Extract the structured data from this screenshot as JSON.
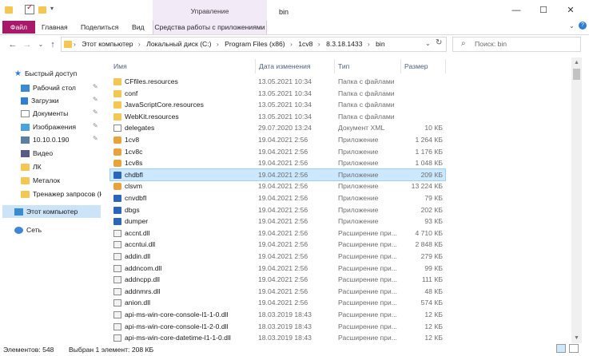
{
  "window": {
    "title": "bin",
    "contextual_group": "Управление",
    "controls": {
      "minimize": "—",
      "maximize": "☐",
      "close": "✕"
    }
  },
  "ribbon": {
    "tabs": [
      "Файл",
      "Главная",
      "Поделиться",
      "Вид",
      "Средства работы с приложениями"
    ]
  },
  "address": {
    "crumbs": [
      "Этот компьютер",
      "Локальный диск (C:)",
      "Program Files (x86)",
      "1cv8",
      "8.3.18.1433",
      "bin"
    ],
    "separator": "›",
    "search_placeholder": "Поиск: bin"
  },
  "nav_pane": {
    "items": [
      {
        "label": "Быстрый доступ",
        "icon": "star-icon",
        "pinned": false
      },
      {
        "label": "Рабочий стол",
        "icon": "desktop-icon",
        "pinned": true
      },
      {
        "label": "Загрузки",
        "icon": "downloads-icon",
        "pinned": true
      },
      {
        "label": "Документы",
        "icon": "documents-icon",
        "pinned": true
      },
      {
        "label": "Изображения",
        "icon": "pictures-icon",
        "pinned": true
      },
      {
        "label": "10.10.0.190",
        "icon": "network-drive-icon",
        "pinned": true
      },
      {
        "label": "Видео",
        "icon": "video-icon",
        "pinned": false
      },
      {
        "label": "ЛК",
        "icon": "folder-icon",
        "pinned": false
      },
      {
        "label": "Металок",
        "icon": "folder-icon",
        "pinned": false
      },
      {
        "label": "Тренажер запросов (К",
        "icon": "folder-icon",
        "pinned": false
      },
      {
        "label": "Этот компьютер",
        "icon": "this-pc-icon",
        "pinned": false,
        "selected": true
      },
      {
        "label": "Сеть",
        "icon": "network-icon",
        "pinned": false
      }
    ]
  },
  "columns": [
    "Имя",
    "Дата изменения",
    "Тип",
    "Размер"
  ],
  "files": [
    {
      "name": "CFfiles.resources",
      "date": "13.05.2021 10:34",
      "type": "Папка с файлами",
      "size": "",
      "icon": "folder"
    },
    {
      "name": "conf",
      "date": "13.05.2021 10:34",
      "type": "Папка с файлами",
      "size": "",
      "icon": "folder"
    },
    {
      "name": "JavaScriptCore.resources",
      "date": "13.05.2021 10:34",
      "type": "Папка с файлами",
      "size": "",
      "icon": "folder"
    },
    {
      "name": "WebKit.resources",
      "date": "13.05.2021 10:34",
      "type": "Папка с файлами",
      "size": "",
      "icon": "folder"
    },
    {
      "name": "delegates",
      "date": "29.07.2020 13:24",
      "type": "Документ XML",
      "size": "10 КБ",
      "icon": "file"
    },
    {
      "name": "1cv8",
      "date": "19.04.2021 2:56",
      "type": "Приложение",
      "size": "1 264 КБ",
      "icon": "app1c"
    },
    {
      "name": "1cv8c",
      "date": "19.04.2021 2:56",
      "type": "Приложение",
      "size": "1 176 КБ",
      "icon": "app1c"
    },
    {
      "name": "1cv8s",
      "date": "19.04.2021 2:56",
      "type": "Приложение",
      "size": "1 048 КБ",
      "icon": "app1c"
    },
    {
      "name": "chdbfl",
      "date": "19.04.2021 2:56",
      "type": "Приложение",
      "size": "209 КБ",
      "icon": "appgen",
      "selected": true
    },
    {
      "name": "clsvm",
      "date": "19.04.2021 2:56",
      "type": "Приложение",
      "size": "13 224 КБ",
      "icon": "app1c"
    },
    {
      "name": "cnvdbfl",
      "date": "19.04.2021 2:56",
      "type": "Приложение",
      "size": "79 КБ",
      "icon": "appgen"
    },
    {
      "name": "dbgs",
      "date": "19.04.2021 2:56",
      "type": "Приложение",
      "size": "202 КБ",
      "icon": "appgen"
    },
    {
      "name": "dumper",
      "date": "19.04.2021 2:56",
      "type": "Приложение",
      "size": "93 КБ",
      "icon": "appgen"
    },
    {
      "name": "accnt.dll",
      "date": "19.04.2021 2:56",
      "type": "Расширение при...",
      "size": "4 710 КБ",
      "icon": "dll"
    },
    {
      "name": "accntui.dll",
      "date": "19.04.2021 2:56",
      "type": "Расширение при...",
      "size": "2 848 КБ",
      "icon": "dll"
    },
    {
      "name": "addin.dll",
      "date": "19.04.2021 2:56",
      "type": "Расширение при...",
      "size": "279 КБ",
      "icon": "dll"
    },
    {
      "name": "addncom.dll",
      "date": "19.04.2021 2:56",
      "type": "Расширение при...",
      "size": "99 КБ",
      "icon": "dll"
    },
    {
      "name": "addncpp.dll",
      "date": "19.04.2021 2:56",
      "type": "Расширение при...",
      "size": "111 КБ",
      "icon": "dll"
    },
    {
      "name": "addnmrs.dll",
      "date": "19.04.2021 2:56",
      "type": "Расширение при...",
      "size": "48 КБ",
      "icon": "dll"
    },
    {
      "name": "anion.dll",
      "date": "19.04.2021 2:56",
      "type": "Расширение при...",
      "size": "574 КБ",
      "icon": "dll"
    },
    {
      "name": "api-ms-win-core-console-l1-1-0.dll",
      "date": "18.03.2019 18:43",
      "type": "Расширение при...",
      "size": "12 КБ",
      "icon": "dll"
    },
    {
      "name": "api-ms-win-core-console-l1-2-0.dll",
      "date": "18.03.2019 18:43",
      "type": "Расширение при...",
      "size": "12 КБ",
      "icon": "dll"
    },
    {
      "name": "api-ms-win-core-datetime-l1-1-0.dll",
      "date": "18.03.2019 18:43",
      "type": "Расширение при...",
      "size": "12 КБ",
      "icon": "dll"
    }
  ],
  "status": {
    "count": "Элементов: 548",
    "selection": "Выбран 1 элемент: 208 КБ"
  },
  "colors": {
    "file_tab": "#a8196a",
    "manage_band": "#f3eaf8",
    "selection": "#cce8ff"
  }
}
